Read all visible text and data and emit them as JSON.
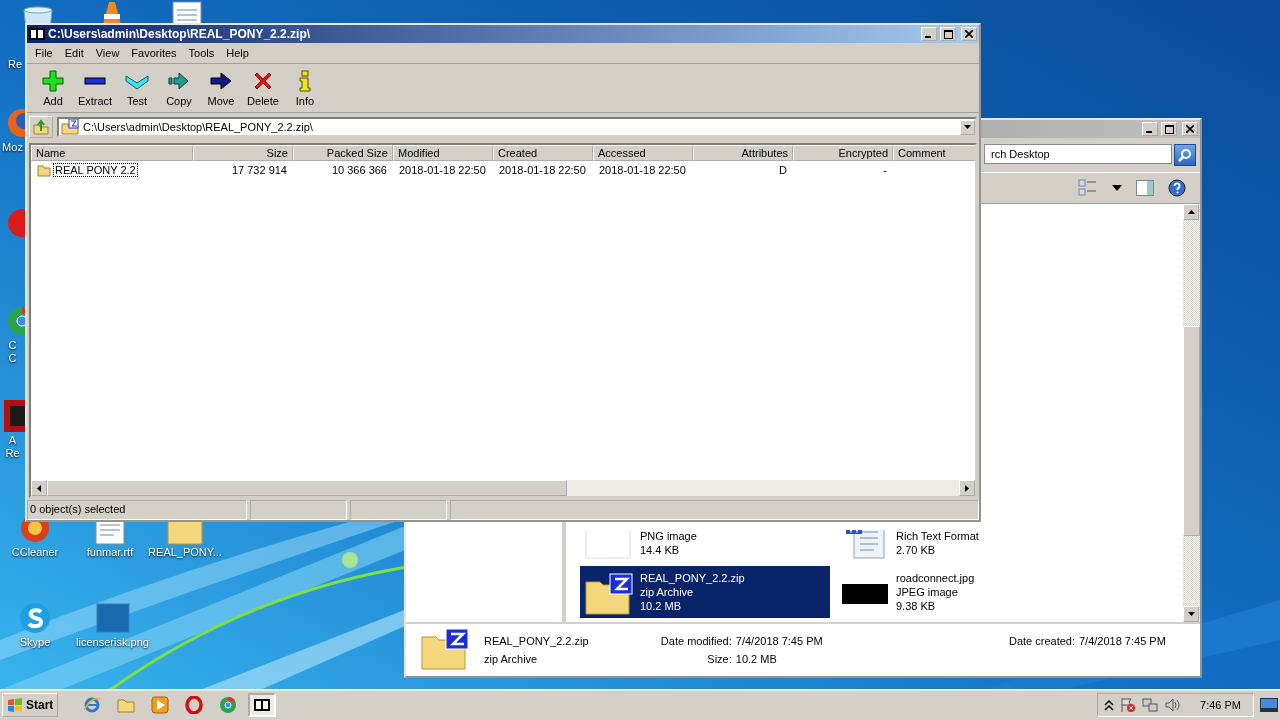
{
  "desktop": {
    "icons": [
      {
        "kind": "recycle",
        "lines": [
          "Re"
        ]
      },
      {
        "kind": "cone"
      },
      {
        "kind": "doc"
      },
      {
        "kind": "firefox",
        "lines": [
          "Moz"
        ]
      },
      {
        "kind": "redball"
      },
      {
        "kind": "chrome",
        "lines": [
          "C",
          "C"
        ]
      },
      {
        "kind": "adobe",
        "lines": [
          "A",
          "Re"
        ]
      },
      {
        "kind": "ccleaner",
        "lines": [
          "CCleaner"
        ]
      },
      {
        "kind": "doc",
        "lines": [
          "funmar.rtf"
        ]
      },
      {
        "kind": "zip",
        "lines": [
          "REAL_PONY..."
        ]
      },
      {
        "kind": "skype",
        "lines": [
          "Skype"
        ]
      },
      {
        "kind": "blank",
        "lines": [
          "licenserisk.png"
        ]
      }
    ]
  },
  "explorer_window": {
    "search": {
      "value": "rch Desktop"
    },
    "files": [
      {
        "kind": "png",
        "type": "PNG image",
        "size": "14.4 KB",
        "selected": false
      },
      {
        "kind": "rtf",
        "type": "Rich Text Format",
        "size": "2.70 KB",
        "selected": false
      },
      {
        "kind": "zip",
        "name": "REAL_PONY_2.2.zip",
        "type": "zip Archive",
        "size": "10.2 MB",
        "selected": true
      },
      {
        "kind": "jpg",
        "name": "roadconnect.jpg",
        "type": "JPEG image",
        "size": "9.38 KB",
        "selected": false
      }
    ],
    "details": {
      "name": "REAL_PONY_2.2.zip",
      "type": "zip Archive",
      "fields": [
        {
          "label": "Date modified:",
          "value": "7/4/2018 7:45 PM"
        },
        {
          "label": "Date created:",
          "value": "7/4/2018 7:45 PM"
        },
        {
          "label": "Size:",
          "value": "10.2 MB"
        }
      ]
    }
  },
  "archive_window": {
    "title": "C:\\Users\\admin\\Desktop\\REAL_PONY_2.2.zip\\",
    "menu": [
      "File",
      "Edit",
      "View",
      "Favorites",
      "Tools",
      "Help"
    ],
    "toolbar": [
      {
        "kind": "add",
        "label": "Add"
      },
      {
        "kind": "extract",
        "label": "Extract"
      },
      {
        "kind": "test",
        "label": "Test"
      },
      {
        "kind": "copy",
        "label": "Copy"
      },
      {
        "kind": "move",
        "label": "Move"
      },
      {
        "kind": "delete",
        "label": "Delete"
      },
      {
        "kind": "info",
        "label": "Info"
      }
    ],
    "address": "C:\\Users\\admin\\Desktop\\REAL_PONY_2.2.zip\\",
    "columns": [
      "Name",
      "Size",
      "Packed Size",
      "Modified",
      "Created",
      "Accessed",
      "Attributes",
      "Encrypted",
      "Comment"
    ],
    "rows": [
      {
        "focused": true,
        "cells": [
          "REAL PONY 2.2",
          "17 732 914",
          "10 366 366",
          "2018-01-18 22:50",
          "2018-01-18 22:50",
          "2018-01-18 22:50",
          "D",
          "-",
          ""
        ]
      }
    ],
    "status_bar": [
      "0 object(s) selected"
    ]
  },
  "taskbar": {
    "start": "Start",
    "apps": [
      {
        "kind": "ie",
        "selected": false
      },
      {
        "kind": "folder",
        "selected": false
      },
      {
        "kind": "media",
        "selected": false
      },
      {
        "kind": "opera",
        "selected": false
      },
      {
        "kind": "chrome",
        "selected": false
      },
      {
        "kind": "sevenzip",
        "selected": true
      }
    ],
    "clock": "7:46 PM"
  }
}
